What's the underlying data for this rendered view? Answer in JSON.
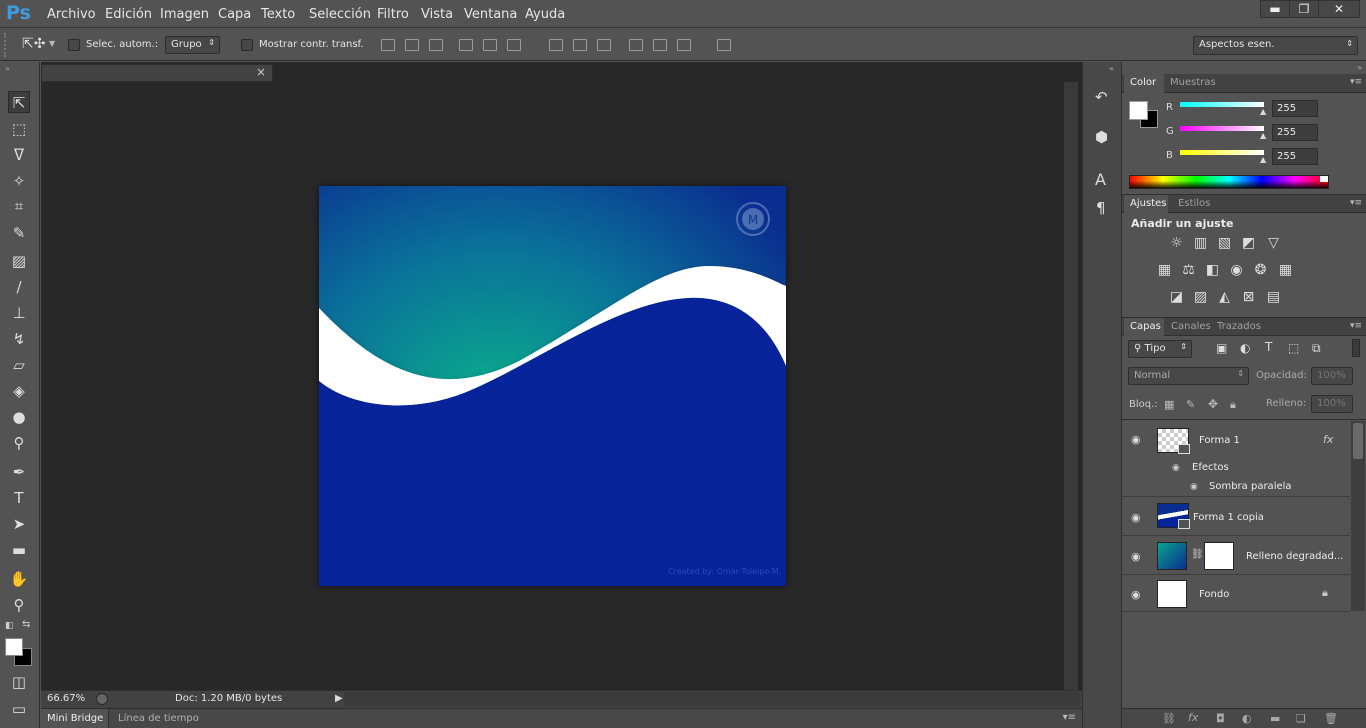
{
  "app": {
    "logo": "Ps"
  },
  "menu": [
    "Archivo",
    "Edición",
    "Imagen",
    "Capa",
    "Texto",
    "Selección",
    "Filtro",
    "Vista",
    "Ventana",
    "Ayuda"
  ],
  "window_controls": {
    "minimize": "▬",
    "restore": "❐",
    "close": "✕"
  },
  "options_bar": {
    "auto_select_label": "Selec. autom.:",
    "auto_select_value": "Grupo",
    "show_transform_label": "Mostrar contr. transf.",
    "workspace": "Aspectos esen."
  },
  "document": {
    "close_glyph": "×",
    "watermark": "Created by: Omar Tolelpo M.",
    "zoom": "66.67%",
    "doc_info": "Doc: 1.20 MB/0 bytes"
  },
  "bottom_tabs": [
    "Mini Bridge",
    "Línea de tiempo"
  ],
  "color_panel": {
    "tabs": [
      "Color",
      "Muestras"
    ],
    "channels": [
      {
        "label": "R",
        "value": "255",
        "color": "#00e5ff"
      },
      {
        "label": "G",
        "value": "255",
        "color": "#ff33ff"
      },
      {
        "label": "B",
        "value": "255",
        "color": "#ffff00"
      }
    ]
  },
  "adjustments_panel": {
    "tabs": [
      "Ajustes",
      "Estilos"
    ],
    "heading": "Añadir un ajuste",
    "row1": [
      "brightness-icon",
      "levels-icon",
      "curves-icon",
      "exposure-icon",
      "vibrance-icon"
    ],
    "row2": [
      "hue-saturation-icon",
      "color-balance-icon",
      "black-white-icon",
      "photo-filter-icon",
      "channel-mixer-icon",
      "color-lookup-icon"
    ],
    "row3": [
      "invert-icon",
      "posterize-icon",
      "threshold-icon",
      "selective-color-icon",
      "gradient-map-icon"
    ]
  },
  "layers_panel": {
    "tabs": [
      "Capas",
      "Canales",
      "Trazados"
    ],
    "filter_label": "Tipo",
    "blend_mode": "Normal",
    "opacity_label": "Opacidad:",
    "opacity_value": "100%",
    "lock_label": "Bloq.:",
    "fill_label": "Relleno:",
    "fill_value": "100%",
    "layers": [
      {
        "name": "Forma 1",
        "fx": "fx",
        "effects_label": "Efectos",
        "effect": "Sombra paralela"
      },
      {
        "name": "Forma 1 copia"
      },
      {
        "name": "Relleno degradad..."
      },
      {
        "name": "Fondo"
      }
    ]
  },
  "colors": {
    "accent": "#3d9be0",
    "canvas_blue": "#06239a",
    "teal": "#0aa58e"
  }
}
